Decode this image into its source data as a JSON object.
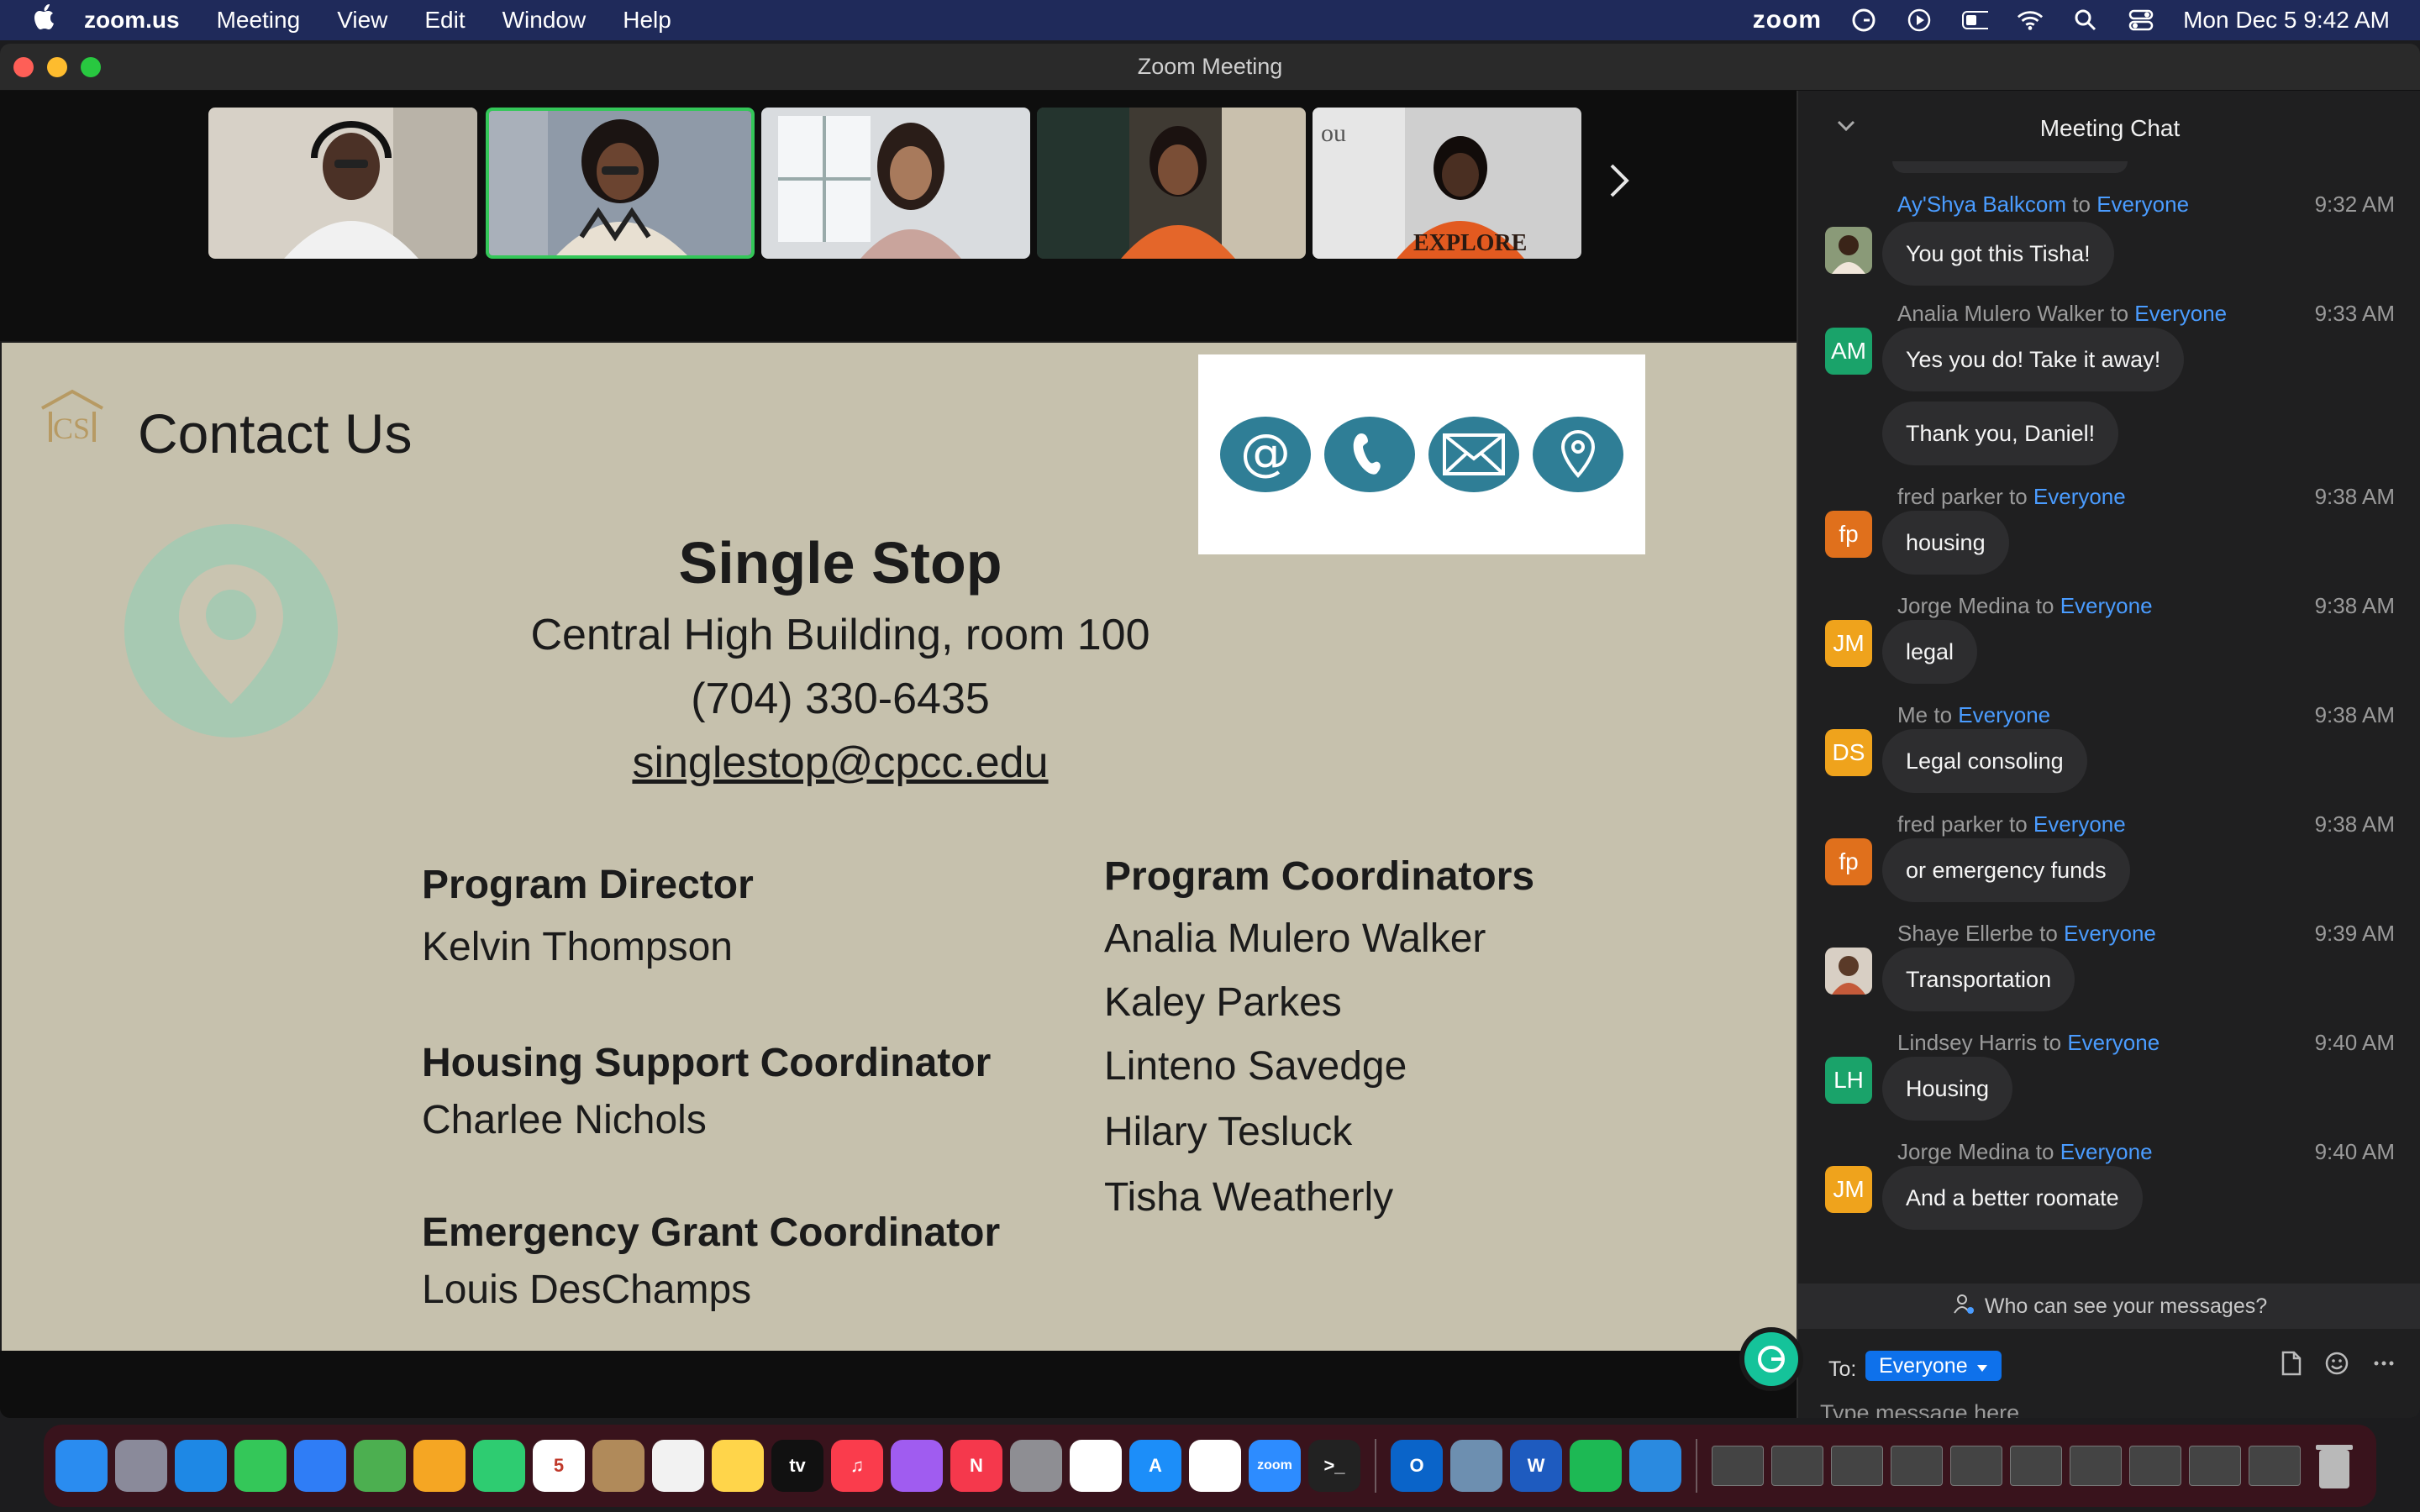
{
  "menubar": {
    "app": "zoom.us",
    "items": [
      "Meeting",
      "View",
      "Edit",
      "Window",
      "Help"
    ],
    "zoom_word": "zoom",
    "datetime": "Mon Dec 5  9:42 AM"
  },
  "window": {
    "title": "Zoom Meeting"
  },
  "slide": {
    "heading": "Contact Us",
    "org_name": "Single Stop",
    "address": "Central High Building, room 100",
    "phone": "(704) 330-6435",
    "email": "singlestop@cpcc.edu",
    "left_col": [
      {
        "label": "Program Director",
        "name": "Kelvin Thompson"
      },
      {
        "label": "Housing Support Coordinator",
        "name": "Charlee Nichols"
      },
      {
        "label": "Emergency Grant Coordinator",
        "name": "Louis DesChamps"
      }
    ],
    "coordinators_label": "Program Coordinators",
    "coordinators": [
      "Analia Mulero Walker",
      "Kaley Parkes",
      "Linteno Savedge",
      "Hilary Tesluck",
      "Tisha Weatherly"
    ]
  },
  "chat": {
    "title": "Meeting Chat",
    "messages": [
      {
        "sender": "Ay'Shya Balkcom",
        "to": "to",
        "audience": "Everyone",
        "time": "9:32 AM",
        "text": "You got this Tisha!",
        "initials": "",
        "avatar_color": "#6b5a4a"
      },
      {
        "sender": "Analia Mulero Walker",
        "to": "to",
        "audience": "Everyone",
        "time": "9:33 AM",
        "text": "Yes you do! Take it away!",
        "initials": "AM",
        "avatar_color": "#1aa36a"
      },
      {
        "text": "Thank you, Daniel!"
      },
      {
        "sender": "fred parker",
        "to": "to",
        "audience": "Everyone",
        "time": "9:38 AM",
        "text": "housing",
        "initials": "fp",
        "avatar_color": "#e0701c"
      },
      {
        "sender": "Jorge Medina",
        "to": "to",
        "audience": "Everyone",
        "time": "9:38 AM",
        "text": "legal",
        "initials": "JM",
        "avatar_color": "#efa31c"
      },
      {
        "sender": "Me",
        "to": "to",
        "audience": "Everyone",
        "time": "9:38 AM",
        "text": "Legal consoling",
        "initials": "DS",
        "avatar_color": "#efa31c"
      },
      {
        "sender": "fred parker",
        "to": "to",
        "audience": "Everyone",
        "time": "9:38 AM",
        "text": "or emergency funds",
        "initials": "fp",
        "avatar_color": "#e0701c"
      },
      {
        "sender": "Shaye Ellerbe",
        "to": "to",
        "audience": "Everyone",
        "time": "9:39 AM",
        "text": "Transportation",
        "initials": "",
        "avatar_color": "#7a5e4c"
      },
      {
        "sender": "Lindsey Harris",
        "to": "to",
        "audience": "Everyone",
        "time": "9:40 AM",
        "text": "Housing",
        "initials": "LH",
        "avatar_color": "#1aa36a"
      },
      {
        "sender": "Jorge Medina",
        "to": "to",
        "audience": "Everyone",
        "time": "9:40 AM",
        "text": "And a better roomate",
        "initials": "JM",
        "avatar_color": "#efa31c"
      }
    ],
    "who_can_see": "Who can see your messages?",
    "to_label": "To:",
    "to_value": "Everyone",
    "placeholder": "Type message here..."
  },
  "dock": {
    "apps": [
      {
        "name": "finder",
        "label": "",
        "color": "#2a8cf0"
      },
      {
        "name": "launchpad",
        "label": "",
        "color": "#8a8a9a"
      },
      {
        "name": "safari",
        "label": "",
        "color": "#1e88e5"
      },
      {
        "name": "messages",
        "label": "",
        "color": "#34c759"
      },
      {
        "name": "mail",
        "label": "",
        "color": "#2f7df6"
      },
      {
        "name": "maps",
        "label": "",
        "color": "#4caf50"
      },
      {
        "name": "photos",
        "label": "",
        "color": "#f5a623"
      },
      {
        "name": "facetime",
        "label": "",
        "color": "#2ecc71"
      },
      {
        "name": "calendar",
        "label": "5",
        "color": "#ffffff"
      },
      {
        "name": "contacts",
        "label": "",
        "color": "#b08a5a"
      },
      {
        "name": "reminders",
        "label": "",
        "color": "#f2f2f2"
      },
      {
        "name": "notes",
        "label": "",
        "color": "#ffd54a"
      },
      {
        "name": "tv",
        "label": "tv",
        "color": "#111111"
      },
      {
        "name": "music",
        "label": "♫",
        "color": "#fa3c4c"
      },
      {
        "name": "podcasts",
        "label": "",
        "color": "#a05cf0"
      },
      {
        "name": "news",
        "label": "N",
        "color": "#f5384c"
      },
      {
        "name": "system-preferences",
        "label": "",
        "color": "#8e8e93"
      },
      {
        "name": "slack",
        "label": "",
        "color": "#ffffff"
      },
      {
        "name": "app-store",
        "label": "A",
        "color": "#1c8ef9"
      },
      {
        "name": "chrome",
        "label": "",
        "color": "#ffffff"
      },
      {
        "name": "zoom",
        "label": "zoom",
        "color": "#2d8cff"
      },
      {
        "name": "terminal",
        "label": ">_",
        "color": "#222222"
      }
    ],
    "apps_right": [
      {
        "name": "outlook",
        "label": "O",
        "color": "#0a64c9"
      },
      {
        "name": "preview",
        "label": "",
        "color": "#6d8fb0"
      },
      {
        "name": "word",
        "label": "W",
        "color": "#1e5bbf"
      },
      {
        "name": "spotify",
        "label": "",
        "color": "#1db954"
      },
      {
        "name": "vscode",
        "label": "",
        "color": "#2a8ae0"
      }
    ],
    "colors": {
      "trash": "#b9b9b9"
    }
  }
}
